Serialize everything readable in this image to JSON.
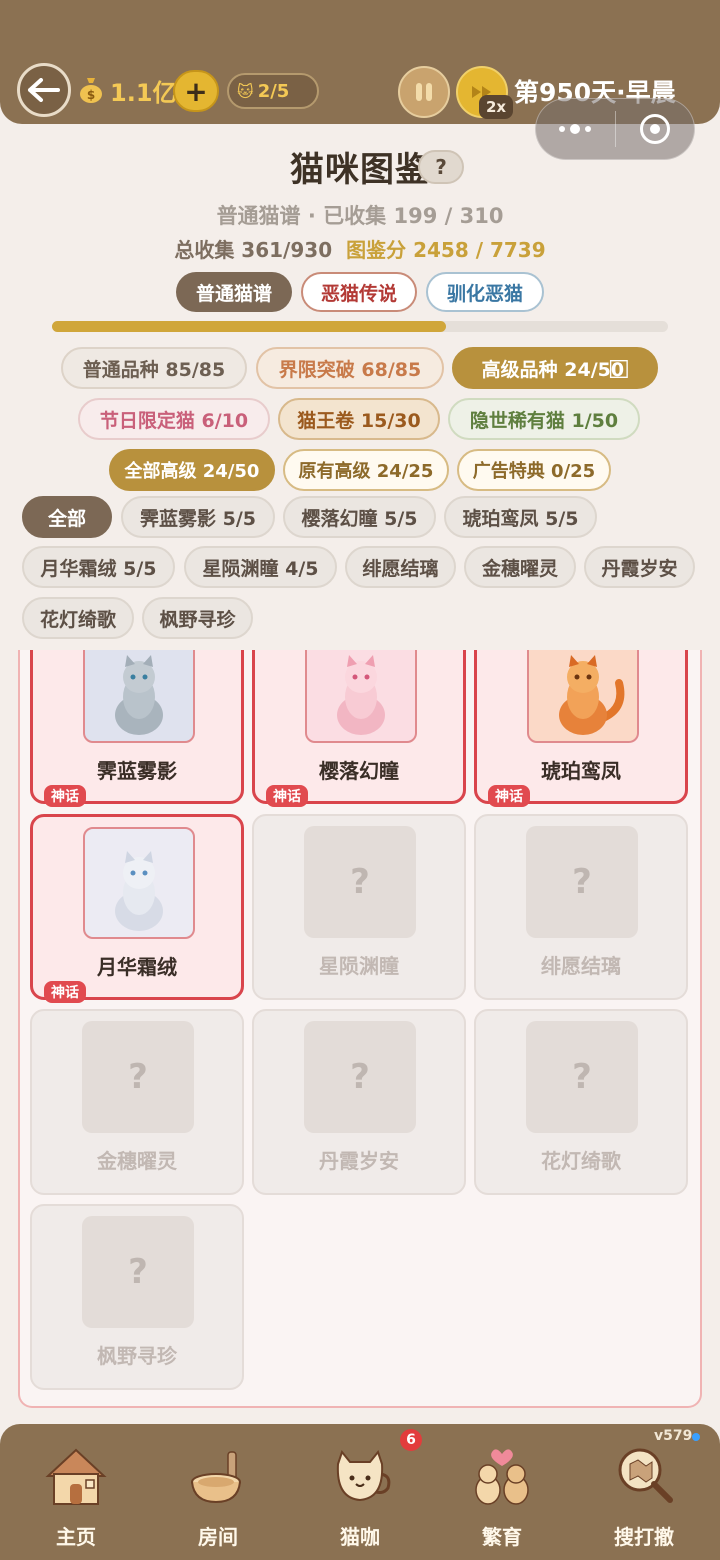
{
  "header": {
    "coins": "1.1亿",
    "plus_label": "+",
    "cat_slots": "2/5",
    "speed_tag": "2x",
    "day": "第950天·早晨"
  },
  "title": "猫咪图鉴",
  "help_label": "?",
  "stats": {
    "line1": "普通猫谱 · 已收集 199 / 310",
    "total": "总收集 361/930",
    "score": "图鉴分 2458 / 7739"
  },
  "main_tabs": [
    {
      "label": "普通猫谱",
      "active": true
    },
    {
      "label": "恶猫传说",
      "active": false
    },
    {
      "label": "驯化恶猫",
      "active": false
    }
  ],
  "progress": 0.64,
  "category_chips": [
    {
      "label": "普通品种 85/85"
    },
    {
      "label": "界限突破 68/85"
    },
    {
      "label": "高级品种 24/50 ⃞",
      "active": true
    },
    {
      "label": "节日限定猫 6/10"
    },
    {
      "label": "猫王卷 15/30"
    },
    {
      "label": "隐世稀有猫 1/50"
    },
    {
      "label": "全部高级 24/50",
      "active": true
    },
    {
      "label": "原有高级 24/25"
    },
    {
      "label": "广告特典 0/25"
    }
  ],
  "filter_chips": [
    {
      "label": "全部",
      "active": true
    },
    {
      "label": "霁蓝雾影 5/5"
    },
    {
      "label": "樱落幻瞳 5/5"
    },
    {
      "label": "琥珀鸾凤 5/5"
    },
    {
      "label": "月华霜绒 5/5"
    },
    {
      "label": "星陨渊瞳 4/5"
    },
    {
      "label": "绯愿结璃"
    },
    {
      "label": "金穗曜灵"
    },
    {
      "label": "丹霞岁安"
    },
    {
      "label": "花灯绮歌"
    },
    {
      "label": "枫野寻珍"
    }
  ],
  "cards": [
    {
      "name": "霁蓝雾影",
      "owned": true,
      "badge": "神话"
    },
    {
      "name": "樱落幻瞳",
      "owned": true,
      "badge": "神话"
    },
    {
      "name": "琥珀鸾凤",
      "owned": true,
      "badge": "神话"
    },
    {
      "name": "月华霜绒",
      "owned": true,
      "badge": "神话"
    },
    {
      "name": "星陨渊瞳",
      "owned": false,
      "placeholder": "?"
    },
    {
      "name": "绯愿结璃",
      "owned": false,
      "placeholder": "?"
    },
    {
      "name": "金穗曜灵",
      "owned": false,
      "placeholder": "?"
    },
    {
      "name": "丹霞岁安",
      "owned": false,
      "placeholder": "?"
    },
    {
      "name": "花灯绮歌",
      "owned": false,
      "placeholder": "?"
    },
    {
      "name": "枫野寻珍",
      "owned": false,
      "placeholder": "?"
    }
  ],
  "nav": [
    {
      "label": "主页",
      "icon": "house-icon"
    },
    {
      "label": "房间",
      "icon": "bowl-icon"
    },
    {
      "label": "猫咖",
      "icon": "cat-cup-icon"
    },
    {
      "label": "繁育",
      "icon": "breeding-cats-icon"
    },
    {
      "label": "搜打撤",
      "icon": "magnifier-map-icon"
    }
  ],
  "nav_badge": "6",
  "version": "v579",
  "colors": {
    "header_brown": "#8b7152",
    "gold": "#d0a63a",
    "owned_border": "#d9454c",
    "myth_badge": "#e14a4f"
  }
}
